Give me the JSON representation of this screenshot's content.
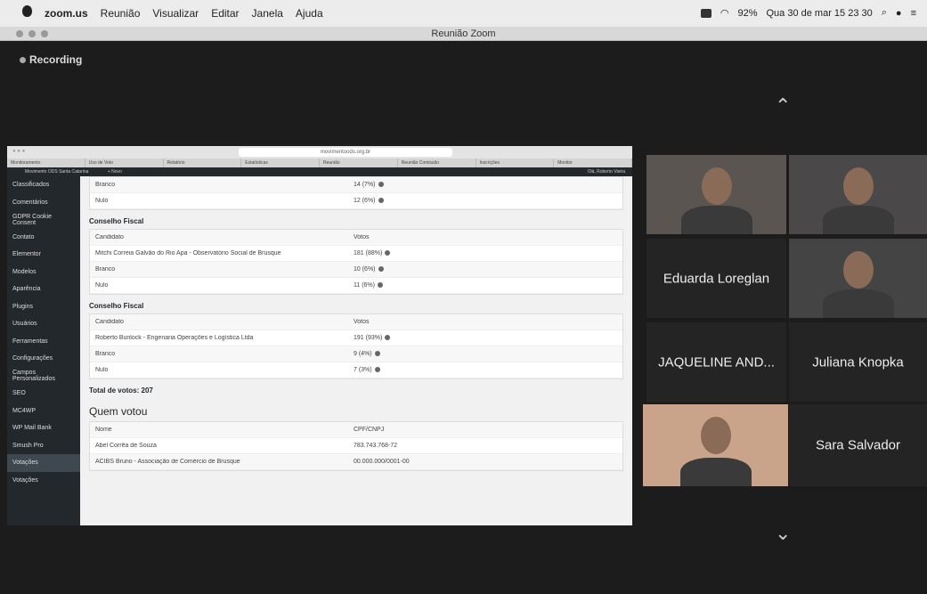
{
  "menubar": {
    "app": "zoom.us",
    "items": [
      "Reunião",
      "Visualizar",
      "Editar",
      "Janela",
      "Ajuda"
    ],
    "battery": "92%",
    "datetime": "Qua 30 de mar  15 23 30"
  },
  "window": {
    "title": "Reunião Zoom"
  },
  "zoom": {
    "recording": "Recording",
    "chevron_up": "⌃",
    "chevron_down": "⌄"
  },
  "share": {
    "browser_tabs": [
      "Monitoramento",
      "Uso de Voto",
      "Relatório",
      "Estatísticas",
      "Reunião",
      "Reunião Comissão",
      "Inscrições",
      "Monitor"
    ],
    "wp_bar": {
      "site": "Movimento ODS Santa Catarina",
      "new": "+ Novo",
      "right": "Olá, Roberto Vieira"
    },
    "sidebar": [
      "Classificados",
      "Comentários",
      "GDPR Cookie Consent",
      "Contato",
      "Elementor",
      "Modelos",
      "Aparência",
      "Plugins",
      "Usuários",
      "Ferramentas",
      "Configurações",
      "Campos Personalizados",
      "SEO",
      "MC4WP",
      "WP Mail Bank",
      "Smush Pro",
      "Votações",
      "Votações"
    ],
    "top_rows": [
      {
        "name": "Branco",
        "votes": "14 (7%)"
      },
      {
        "name": "Nulo",
        "votes": "12 (6%)"
      }
    ],
    "sections": [
      {
        "title": "Conselho Fiscal",
        "header": [
          "Candidato",
          "Votos"
        ],
        "rows": [
          {
            "name": "Mitchi Correia Galvão do Rio Apa - Observatório Social de Brusque",
            "votes": "181 (88%)"
          },
          {
            "name": "Branco",
            "votes": "10 (6%)"
          },
          {
            "name": "Nulo",
            "votes": "11 (6%)"
          }
        ]
      },
      {
        "title": "Conselho Fiscal",
        "header": [
          "Candidato",
          "Votos"
        ],
        "rows": [
          {
            "name": "Roberto Bunlock - Engenaria Operações e Logística Ltda",
            "votes": "191 (93%)"
          },
          {
            "name": "Branco",
            "votes": "9 (4%)"
          },
          {
            "name": "Nulo",
            "votes": "7 (3%)"
          }
        ]
      }
    ],
    "total": "Total de votos: 207",
    "quem_votou": {
      "title": "Quem votou",
      "header": [
        "Nome",
        "CPF/CNPJ"
      ],
      "rows": [
        {
          "name": "Abel Corrêa de Souza",
          "id": "783.743.768-72"
        },
        {
          "name": "ACIBS Bruno - Associação de Comércio de Brusque",
          "id": "00.000.000/0001-00"
        }
      ]
    }
  },
  "participants": [
    {
      "name": "",
      "video": true
    },
    {
      "name": "",
      "video": true
    },
    {
      "name": "Eduarda Loreglan",
      "video": false
    },
    {
      "name": "",
      "video": true
    },
    {
      "name": "JAQUELINE AND...",
      "video": false
    },
    {
      "name": "Juliana Knopka",
      "video": false
    },
    {
      "name": "",
      "video": true
    },
    {
      "name": "Sara Salvador",
      "video": false
    }
  ],
  "colors": {
    "zoom_bg": "#1c1c1c",
    "tile": "#242424",
    "wp_dark": "#23282d"
  }
}
